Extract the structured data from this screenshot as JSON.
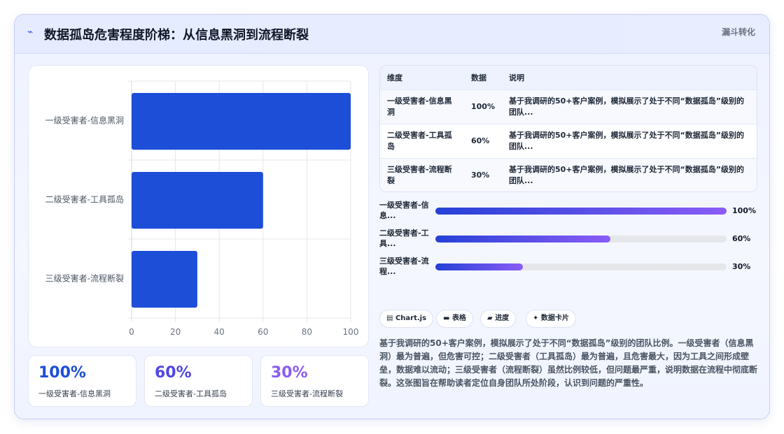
{
  "header": {
    "logo_icon": "bolt-icon",
    "title": "数据孤岛危害程度阶梯：从信息黑洞到流程断裂",
    "tag": "漏斗转化"
  },
  "chart_data": {
    "type": "bar",
    "orientation": "horizontal",
    "categories": [
      "一级受害者-信息黑洞",
      "二级受害者-工具孤岛",
      "三级受害者-流程断裂"
    ],
    "values": [
      100,
      60,
      30
    ],
    "title": "",
    "xlabel": "",
    "ylabel": "",
    "xlim": [
      0,
      100
    ],
    "x_ticks": [
      "0",
      "20",
      "40",
      "60",
      "80",
      "100"
    ],
    "bar_color": "#1d4ed8",
    "grid": true,
    "legend": "none"
  },
  "stats": [
    {
      "value": "100%",
      "label": "一级受害者-信息黑洞",
      "color": "#1d4ed8"
    },
    {
      "value": "60%",
      "label": "二级受害者-工具孤岛",
      "color": "#4f46e5"
    },
    {
      "value": "30%",
      "label": "三级受害者-流程断裂",
      "color": "#8b5cf6"
    }
  ],
  "table": {
    "headers": [
      "维度",
      "数据",
      "说明"
    ],
    "rows": [
      [
        "一级受害者-信息黑洞",
        "100%",
        "基于我调研的50+客户案例，模拟展示了处于不同“数据孤岛”级别的团队..."
      ],
      [
        "二级受害者-工具孤岛",
        "60%",
        "基于我调研的50+客户案例，模拟展示了处于不同“数据孤岛”级别的团队..."
      ],
      [
        "三级受害者-流程断裂",
        "30%",
        "基于我调研的50+客户案例，模拟展示了处于不同“数据孤岛”级别的团队..."
      ]
    ]
  },
  "progress": [
    {
      "label": "一级受害者-信息...",
      "value": 100,
      "text": "100%"
    },
    {
      "label": "二级受害者-工具...",
      "value": 60,
      "text": "60%"
    },
    {
      "label": "三级受害者-流程...",
      "value": 30,
      "text": "30%"
    }
  ],
  "chips": [
    {
      "icon": "chart-icon",
      "glyph": "▤",
      "label": "Chart.js"
    },
    {
      "icon": "table-icon",
      "glyph": "▬",
      "label": "表格"
    },
    {
      "icon": "progress-icon",
      "glyph": "▰",
      "label": "进度"
    },
    {
      "icon": "sparkle-icon",
      "glyph": "✦",
      "label": "数据卡片"
    }
  ],
  "description": "基于我调研的50+客户案例，模拟展示了处于不同“数据孤岛”级别的团队比例。一级受害者（信息黑洞）最为普遍，但危害可控；二级受害者（工具孤岛）最为普遍，且危害最大，因为工具之间形成壁垒，数据难以流动；三级受害者（流程断裂）虽然比例较低，但问题最严重，说明数据在流程中彻底断裂。这张图旨在帮助读者定位自身团队所处阶段，认识到问题的严重性。"
}
